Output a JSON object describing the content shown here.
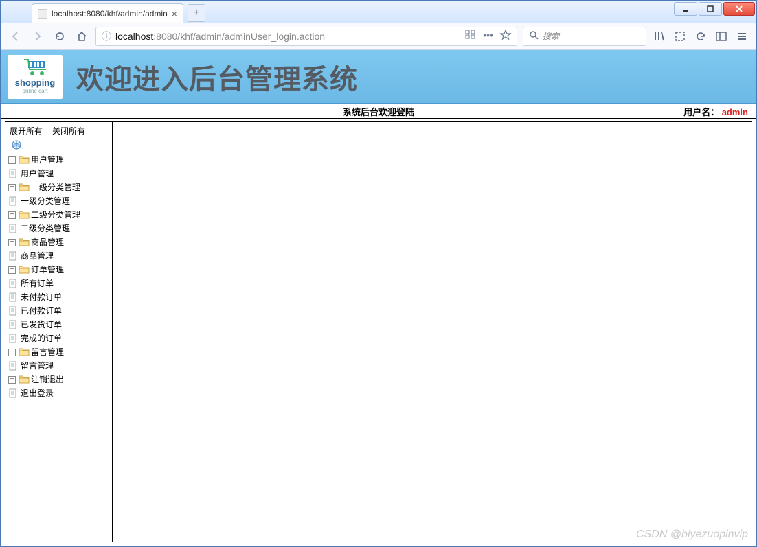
{
  "browser": {
    "tab_title": "localhost:8080/khf/admin/admin",
    "new_tab_label": "+",
    "url_display_prefix": "localhost",
    "url_display_rest": ":8080/khf/admin/adminUser_login.action",
    "search_placeholder": "搜索"
  },
  "banner": {
    "brand": "shopping",
    "brand_sub": "online cart",
    "title": "欢迎进入后台管理系统"
  },
  "status": {
    "welcome": "系统后台欢迎登陆",
    "user_label": "用户名：",
    "username": "admin"
  },
  "sidebar": {
    "expand_all": "展开所有",
    "collapse_all": "关闭所有",
    "nodes": [
      {
        "label": "用户管理",
        "children": [
          {
            "label": "用户管理"
          }
        ]
      },
      {
        "label": "一级分类管理",
        "children": [
          {
            "label": "一级分类管理"
          }
        ]
      },
      {
        "label": "二级分类管理",
        "children": [
          {
            "label": "二级分类管理"
          }
        ]
      },
      {
        "label": "商品管理",
        "children": [
          {
            "label": "商品管理"
          }
        ]
      },
      {
        "label": "订单管理",
        "children": [
          {
            "label": "所有订单"
          },
          {
            "label": "未付款订单"
          },
          {
            "label": "已付款订单"
          },
          {
            "label": "已发货订单"
          },
          {
            "label": "完成的订单"
          }
        ]
      },
      {
        "label": "留言管理",
        "children": [
          {
            "label": "留言管理"
          }
        ]
      },
      {
        "label": "注销退出",
        "children": [
          {
            "label": "退出登录"
          }
        ]
      }
    ]
  },
  "watermark": "CSDN @biyezuopinvip"
}
